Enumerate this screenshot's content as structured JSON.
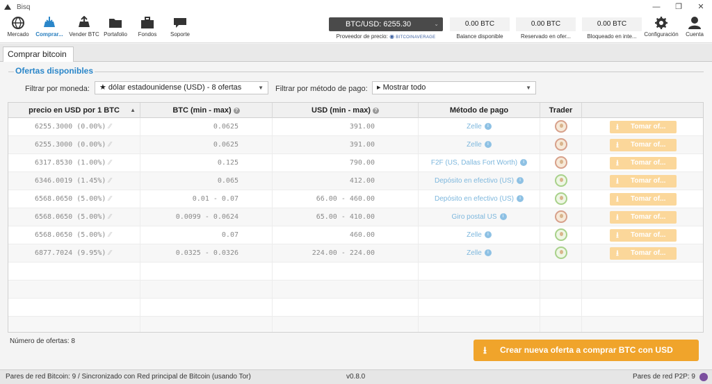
{
  "window": {
    "title": "Bisq"
  },
  "toolbar": {
    "nav": [
      {
        "id": "mercado",
        "label": "Mercado",
        "icon": "globe-icon"
      },
      {
        "id": "comprar",
        "label": "Comprar...",
        "icon": "buy-icon",
        "active": true
      },
      {
        "id": "vender",
        "label": "Vender BTC",
        "icon": "sell-icon"
      },
      {
        "id": "portafolio",
        "label": "Portafolio",
        "icon": "folder-icon"
      },
      {
        "id": "fondos",
        "label": "Fondos",
        "icon": "briefcase-icon"
      },
      {
        "id": "soporte",
        "label": "Soporte",
        "icon": "chat-icon"
      }
    ],
    "price": {
      "value": "BTC/USD: 6255.30",
      "provider_label": "Proveedor de precio:",
      "provider_name": "BITCOINAVERAGE"
    },
    "balances": [
      {
        "value": "0.00 BTC",
        "label": "Balance disponible"
      },
      {
        "value": "0.00 BTC",
        "label": "Reservado en ofer..."
      },
      {
        "value": "0.00 BTC",
        "label": "Bloqueado en inte..."
      }
    ],
    "settings_label": "Configuración",
    "account_label": "Cuenta"
  },
  "tabs": [
    {
      "label": "Comprar bitcoin"
    }
  ],
  "offers": {
    "title": "Ofertas disponibles",
    "currency_filter_label": "Filtrar por moneda:",
    "currency_filter_value": "★ dólar estadounidense (USD) - 8 ofertas",
    "payment_filter_label": "Filtrar por método de pago:",
    "payment_filter_value": "▸ Mostrar todo",
    "columns": {
      "price": "precio en USD por 1 BTC",
      "btc": "BTC (min - max)",
      "usd": "USD (min - max)",
      "payment": "Método de pago",
      "trader": "Trader"
    },
    "take_label": "Tomar of...",
    "rows": [
      {
        "price": "6255.3000 (0.00%)",
        "btc": "0.0625",
        "usd": "391.00",
        "payment": "Zelle",
        "avatar": "orange"
      },
      {
        "price": "6255.3000 (0.00%)",
        "btc": "0.0625",
        "usd": "391.00",
        "payment": "Zelle",
        "avatar": "orange"
      },
      {
        "price": "6317.8530 (1.00%)",
        "btc": "0.125",
        "usd": "790.00",
        "payment": "F2F (US, Dallas Fort Worth)",
        "avatar": "orange"
      },
      {
        "price": "6346.0019 (1.45%)",
        "btc": "0.065",
        "usd": "412.00",
        "payment": "Depósito en efectivo (US)",
        "avatar": "green"
      },
      {
        "price": "6568.0650 (5.00%)",
        "btc": "0.01 - 0.07",
        "usd": "66.00 - 460.00",
        "payment": "Depósito en efectivo (US)",
        "avatar": "green"
      },
      {
        "price": "6568.0650 (5.00%)",
        "btc": "0.0099 - 0.0624",
        "usd": "65.00 - 410.00",
        "payment": "Giro postal US",
        "avatar": "orange"
      },
      {
        "price": "6568.0650 (5.00%)",
        "btc": "0.07",
        "usd": "460.00",
        "payment": "Zelle",
        "avatar": "green"
      },
      {
        "price": "6877.7024 (9.95%)",
        "btc": "0.0325 - 0.0326",
        "usd": "224.00 - 224.00",
        "payment": "Zelle",
        "avatar": "green"
      }
    ],
    "count_label": "Número de ofertas: 8",
    "create_button": "Crear nueva oferta a comprar BTC con USD"
  },
  "statusbar": {
    "left": "Pares de red Bitcoin: 9 / Sincronizado con Red principal de Bitcoin (usando Tor)",
    "version": "v0.8.0",
    "right": "Pares de red P2P: 9"
  },
  "colors": {
    "accent": "#2a86c9",
    "action": "#f0a42b",
    "take_disabled": "#fbd79a"
  }
}
